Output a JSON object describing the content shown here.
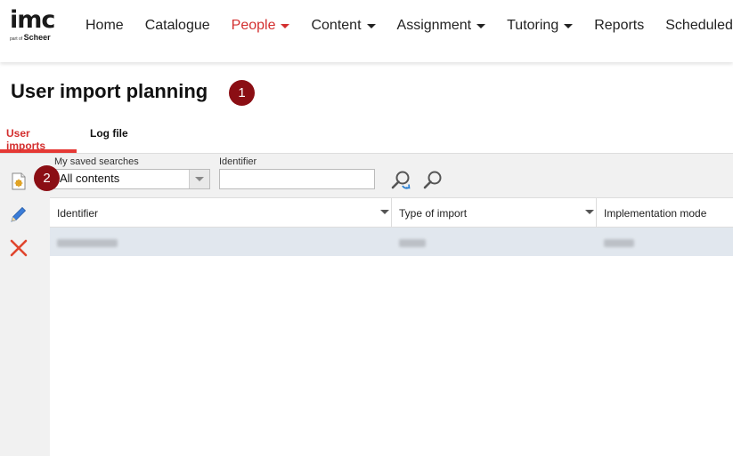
{
  "logo": {
    "main": "imc",
    "sub_small": "part of",
    "sub_brand": "Scheer"
  },
  "nav": {
    "items": [
      {
        "label": "Home",
        "dropdown": false,
        "active": false
      },
      {
        "label": "Catalogue",
        "dropdown": false,
        "active": false
      },
      {
        "label": "People",
        "dropdown": true,
        "active": true
      },
      {
        "label": "Content",
        "dropdown": true,
        "active": false
      },
      {
        "label": "Assignment",
        "dropdown": true,
        "active": false
      },
      {
        "label": "Tutoring",
        "dropdown": true,
        "active": false
      },
      {
        "label": "Reports",
        "dropdown": false,
        "active": false
      },
      {
        "label": "Scheduled J",
        "dropdown": false,
        "active": false
      }
    ]
  },
  "page": {
    "title": "User import planning"
  },
  "badges": {
    "one": "1",
    "two": "2"
  },
  "tabs": [
    {
      "label": "User imports",
      "active": true
    },
    {
      "label": "Log file",
      "active": false
    }
  ],
  "toolbar": {
    "icons": [
      "new-document-icon",
      "edit-pencil-icon",
      "delete-x-icon"
    ]
  },
  "filter": {
    "saved_searches_label": "My saved searches",
    "saved_searches_value": "All contents",
    "identifier_label": "Identifier",
    "identifier_value": "",
    "identifier_placeholder": ""
  },
  "table": {
    "columns": [
      {
        "label": "Identifier"
      },
      {
        "label": "Type of import"
      },
      {
        "label": "Implementation mode"
      }
    ]
  },
  "colors": {
    "accent": "#d32f2f",
    "badge": "#8b0e14",
    "row_selected": "#e1e7ee",
    "toolbar_bg": "#f1f1f1"
  }
}
